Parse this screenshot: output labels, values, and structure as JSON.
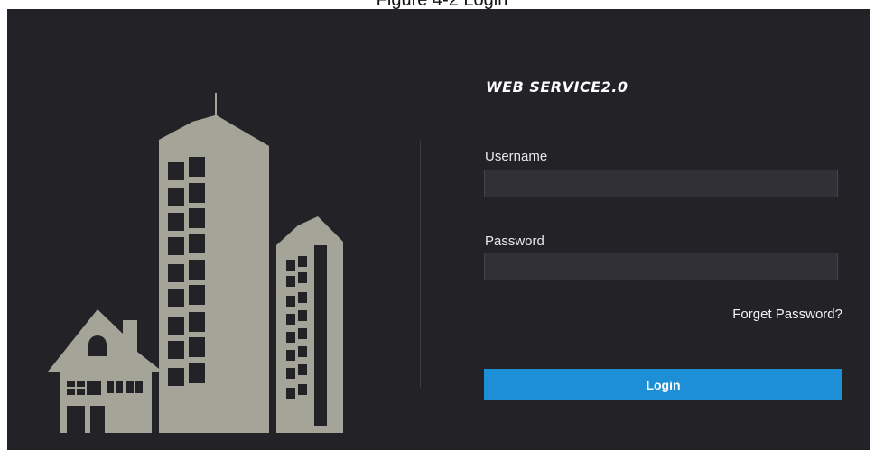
{
  "caption": "Figure 4-2 Login",
  "brand": {
    "title": "WEB SERVICE2.0"
  },
  "form": {
    "username_label": "Username",
    "username_value": "",
    "password_label": "Password",
    "password_value": "",
    "forgot_label": "Forget Password?",
    "login_label": "Login"
  },
  "colors": {
    "background": "#232226",
    "illustration": "#a5a498",
    "accent": "#1d8fd6",
    "field_bg": "#303036"
  },
  "icons": {
    "illustration": "buildings-and-house-illustration"
  }
}
